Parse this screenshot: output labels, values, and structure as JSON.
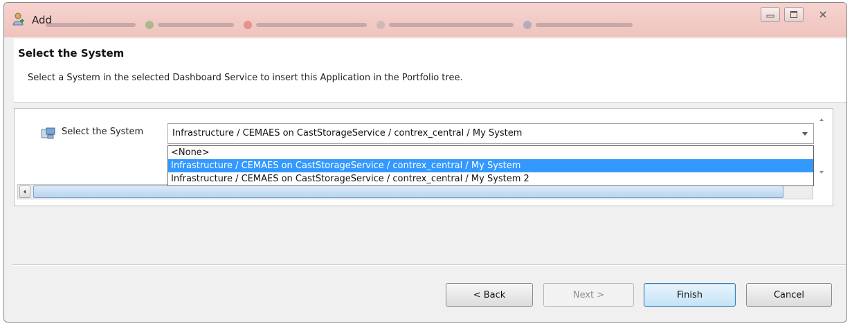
{
  "window": {
    "title": "Add",
    "controls": {
      "minimize": "minimize",
      "maximize": "maximize",
      "close": "close"
    }
  },
  "header": {
    "title": "Select the System",
    "description": "Select a System in the selected Dashboard Service to insert this Application in the Portfolio tree."
  },
  "form": {
    "label": "Select the System",
    "selected_value": "Infrastructure / CEMAES on CastStorageService / contrex_central / My System",
    "options": [
      "<None>",
      "Infrastructure / CEMAES on CastStorageService / contrex_central / My System",
      "Infrastructure / CEMAES on CastStorageService / contrex_central / My System 2"
    ],
    "highlighted_index": 1
  },
  "buttons": {
    "back": "< Back",
    "next": "Next >",
    "finish": "Finish",
    "cancel": "Cancel"
  },
  "colors": {
    "selection": "#3399ff",
    "titlebar": "#f6d3cf"
  }
}
